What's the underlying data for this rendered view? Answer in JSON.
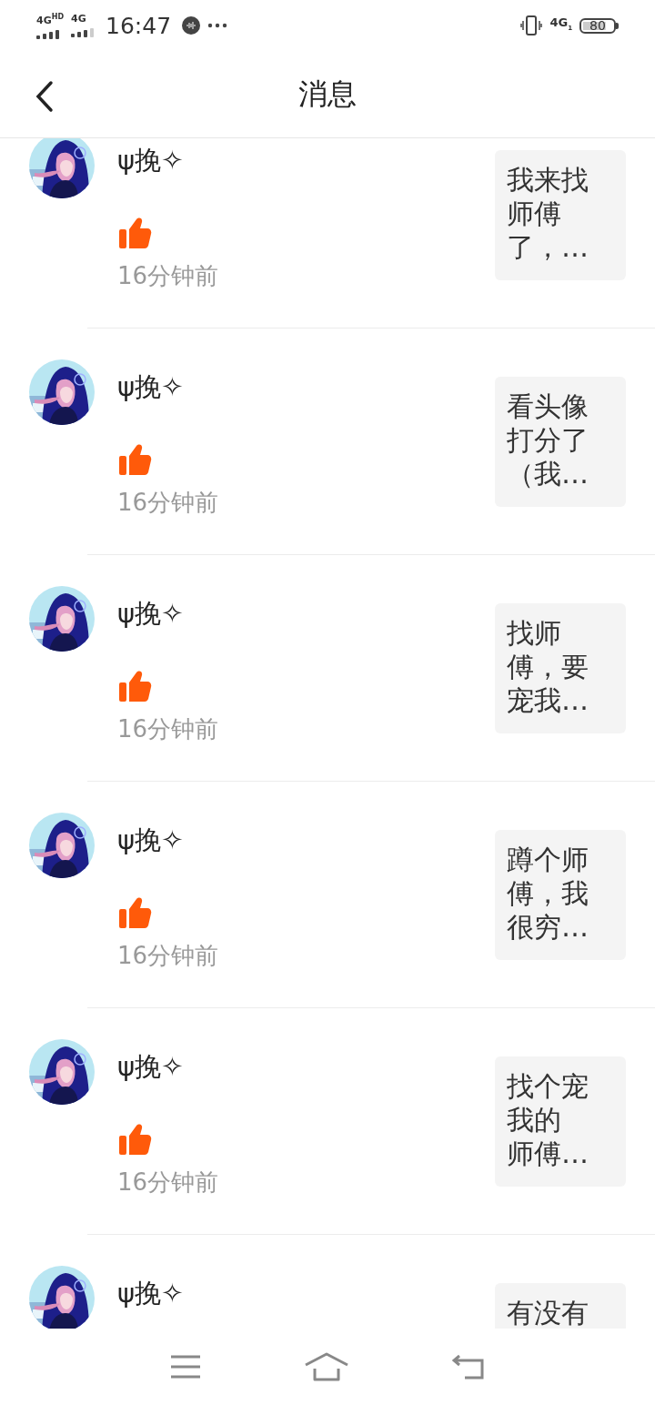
{
  "status_bar": {
    "sim1": "4G$^{HD}$",
    "sim2": "4G",
    "time": "16:47",
    "network": "4G$_{1}$",
    "battery": "80"
  },
  "header": {
    "title": "消息"
  },
  "messages": [
    {
      "user": "ψ挽✧",
      "liked": true,
      "time": "16分钟前",
      "preview_lines": [
        "我来找",
        "师傅",
        "了，…"
      ]
    },
    {
      "user": "ψ挽✧",
      "liked": true,
      "time": "16分钟前",
      "preview_lines": [
        "看头像",
        "打分了",
        "（我…"
      ]
    },
    {
      "user": "ψ挽✧",
      "liked": true,
      "time": "16分钟前",
      "preview_lines": [
        "找师",
        "傅，要",
        "宠我…"
      ]
    },
    {
      "user": "ψ挽✧",
      "liked": true,
      "time": "16分钟前",
      "preview_lines": [
        "蹲个师",
        "傅，我",
        "很穷…"
      ]
    },
    {
      "user": "ψ挽✧",
      "liked": true,
      "time": "16分钟前",
      "preview_lines": [
        "找个宠",
        "我的",
        "师傅…"
      ]
    },
    {
      "user": "ψ挽✧",
      "preview_lines": [
        "有没有"
      ]
    }
  ]
}
